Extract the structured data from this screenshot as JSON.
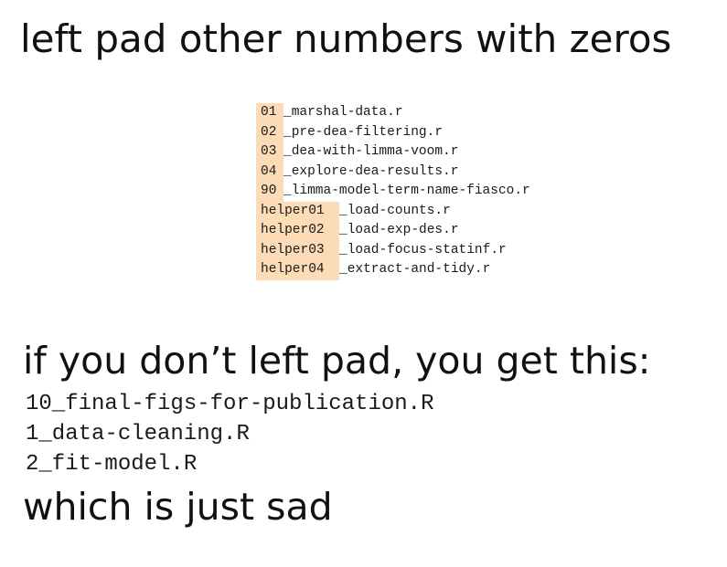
{
  "title": "left pad other numbers with zeros",
  "good_files": [
    {
      "prefix": "01",
      "rest": "_marshal-data.r"
    },
    {
      "prefix": "02",
      "rest": "_pre-dea-filtering.r"
    },
    {
      "prefix": "03",
      "rest": "_dea-with-limma-voom.r"
    },
    {
      "prefix": "04",
      "rest": "_explore-dea-results.r"
    },
    {
      "prefix": "90",
      "rest": "_limma-model-term-name-fiasco.r"
    },
    {
      "prefix": "helper01",
      "rest": "_load-counts.r"
    },
    {
      "prefix": "helper02",
      "rest": "_load-exp-des.r"
    },
    {
      "prefix": "helper03",
      "rest": "_load-focus-statinf.r"
    },
    {
      "prefix": "helper04",
      "rest": "_extract-and-tidy.r"
    }
  ],
  "highlight_color": "#fbdcb7",
  "subheading": "if you don’t left pad, you get this:",
  "bad_files": [
    "10_final-figs-for-publication.R",
    "1_data-cleaning.R",
    "2_fit-model.R"
  ],
  "closing": "which is just sad"
}
